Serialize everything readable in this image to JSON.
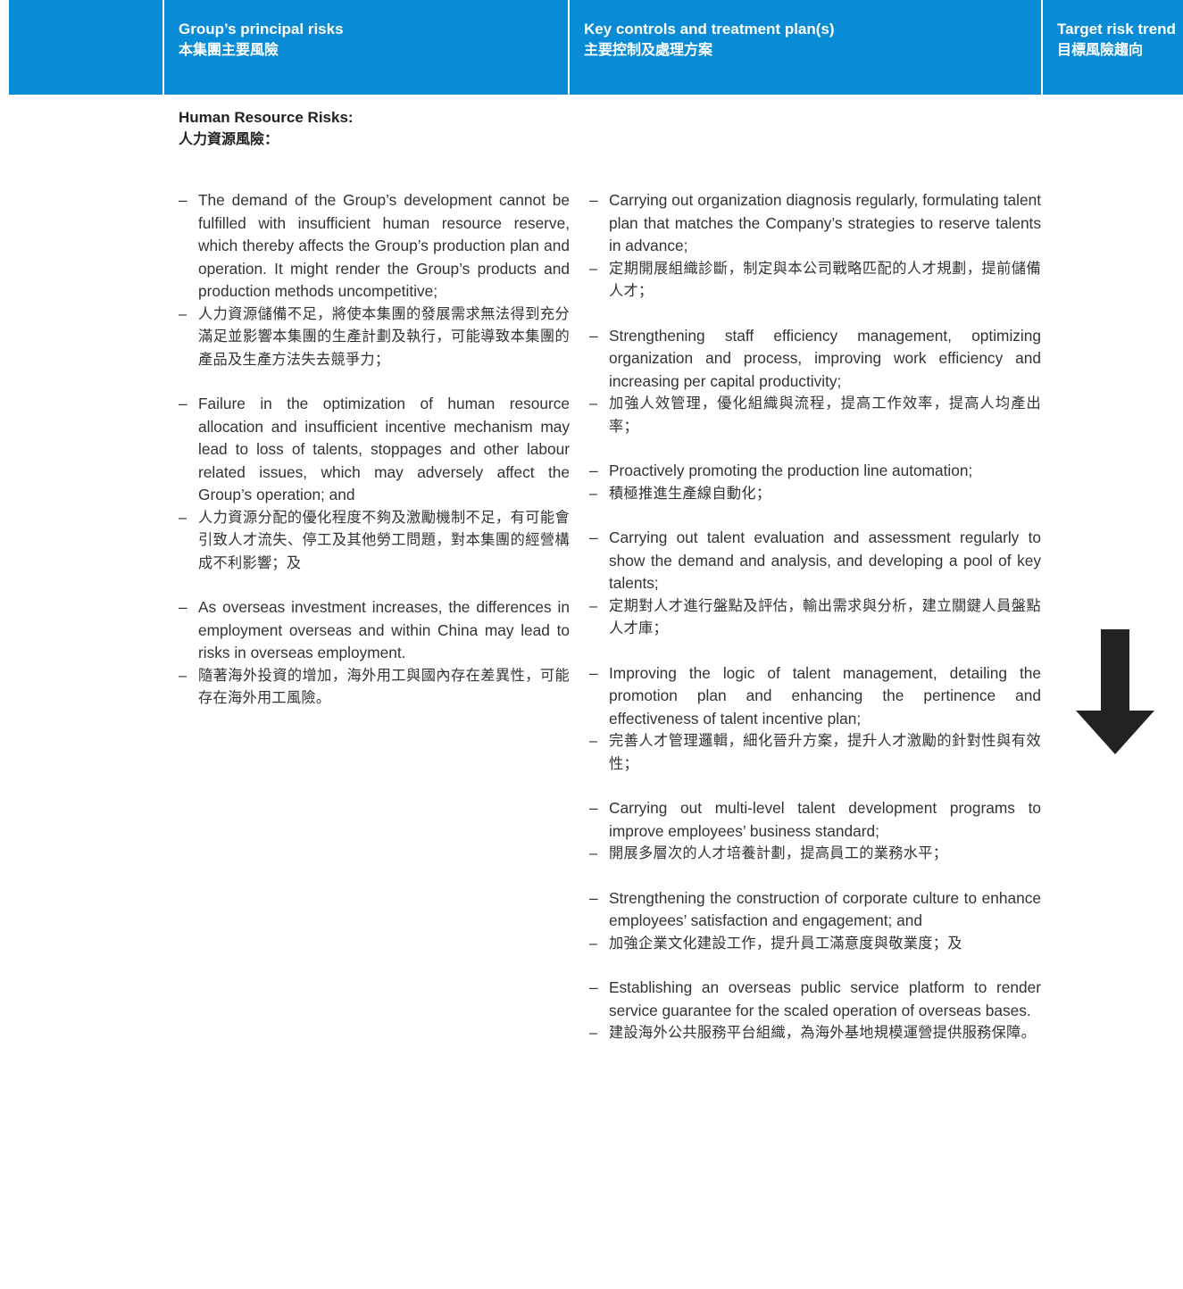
{
  "header": {
    "col1": {
      "en": "Group’s principal risks",
      "zh": "本集團主要風險"
    },
    "col2": {
      "en": "Key controls and treatment plan(s)",
      "zh": "主要控制及處理方案"
    },
    "col3": {
      "en": "Target risk trend",
      "zh": "目標風險趨向"
    }
  },
  "section": {
    "title_en": "Human Resource Risks:",
    "title_zh": "人力資源風險："
  },
  "dash": "–",
  "risks": [
    {
      "en": "The demand of the Group’s development cannot be fulfilled with insufficient human resource reserve, which thereby affects the Group’s production plan and operation. It might render the Group’s products and production methods uncompetitive;",
      "zh": "人力資源儲備不足，將使本集團的發展需求無法得到充分滿足並影響本集團的生產計劃及執行，可能導致本集團的產品及生產方法失去競爭力；"
    },
    {
      "en": "Failure in the optimization of human resource allocation and insufficient incentive mechanism may lead to loss of talents, stoppages and other labour related issues, which may adversely affect the Group’s operation; and",
      "zh": "人力資源分配的優化程度不夠及激勵機制不足，有可能會引致人才流失、停工及其他勞工問題，對本集團的經營構成不利影響；及"
    },
    {
      "en": "As overseas investment increases, the differences in employment overseas and within China may lead to risks in overseas employment.",
      "zh": "隨著海外投資的增加，海外用工與國內存在差異性，可能存在海外用工風險。"
    }
  ],
  "controls": [
    {
      "en": "Carrying out organization diagnosis regularly, formulating talent plan that matches the Company’s strategies to reserve talents in advance;",
      "zh": "定期開展組織診斷，制定與本公司戰略匹配的人才規劃，提前儲備人才；"
    },
    {
      "en": "Strengthening staff efficiency management, optimizing organization and process, improving work efficiency and increasing per capital productivity;",
      "zh": "加強人效管理，優化組織與流程，提高工作效率，提高人均產出率；"
    },
    {
      "en": "Proactively promoting the production line automation;",
      "zh": "積極推進生產線自動化；"
    },
    {
      "en": "Carrying out talent evaluation and assessment regularly to show the demand and analysis, and developing a pool of key talents;",
      "zh": "定期對人才進行盤點及評估，輸出需求與分析，建立關鍵人員盤點人才庫；"
    },
    {
      "en": "Improving the logic of talent management, detailing the promotion plan and enhancing the pertinence and effectiveness of talent incentive plan;",
      "zh": "完善人才管理邏輯，細化晉升方案，提升人才激勵的針對性與有效性；"
    },
    {
      "en": "Carrying out multi-level talent development programs to improve employees’ business standard;",
      "zh": "開展多層次的人才培養計劃，提高員工的業務水平；"
    },
    {
      "en": "Strengthening the construction of corporate culture to enhance employees’ satisfaction and engagement; and",
      "zh": "加強企業文化建設工作，提升員工滿意度與敬業度；及"
    },
    {
      "en": "Establishing an overseas public service platform to render service guarantee for the scaled operation of overseas bases.",
      "zh": "建設海外公共服務平台組織，為海外基地規模運營提供服務保障。"
    }
  ],
  "trend": {
    "icon": "arrow-down-icon",
    "direction": "down",
    "color": "#222222"
  },
  "colors": {
    "header_bg": "#0a8bd6",
    "header_text": "#ffffff"
  }
}
